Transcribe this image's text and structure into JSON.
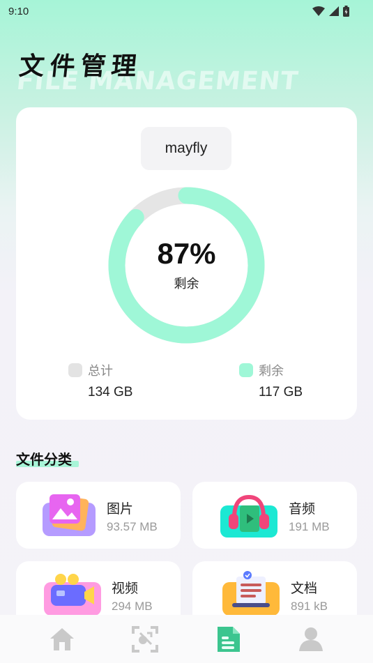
{
  "status_bar": {
    "time": "9:10"
  },
  "header": {
    "title": "文件管理",
    "subtitle": "FILE MANAGEMENT"
  },
  "storage": {
    "device_name": "mayfly",
    "remaining_percent": "87%",
    "remaining_fraction": 0.87,
    "remaining_label": "剩余",
    "total_label": "总计",
    "total_value": "134 GB",
    "free_label": "剩余",
    "free_value": "117 GB"
  },
  "categories_section": {
    "title": "文件分类",
    "items": [
      {
        "name": "图片",
        "size": "93.57 MB",
        "icon": "image-icon"
      },
      {
        "name": "音频",
        "size": "191 MB",
        "icon": "headphones-icon"
      },
      {
        "name": "视频",
        "size": "294 MB",
        "icon": "video-camera-icon"
      },
      {
        "name": "文档",
        "size": "891 kB",
        "icon": "document-icon"
      }
    ]
  },
  "tab_bar": {
    "tabs": [
      {
        "icon": "home-icon",
        "active": false
      },
      {
        "icon": "scan-icon",
        "active": false
      },
      {
        "icon": "file-icon",
        "active": true
      },
      {
        "icon": "profile-icon",
        "active": false
      }
    ]
  },
  "colors": {
    "accent": "#9ff7d7",
    "ring_track": "#e5e5e5",
    "tab_inactive": "#c9c9c9",
    "tab_active": "#3cc58f"
  }
}
